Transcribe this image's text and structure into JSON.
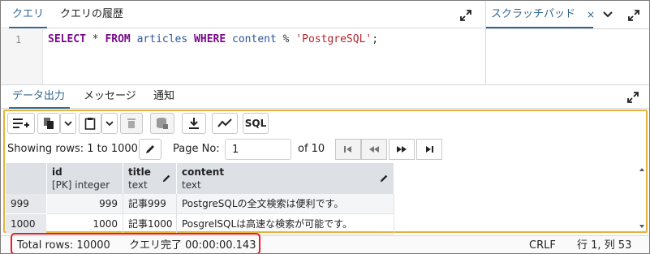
{
  "editor_tabs": {
    "query": "クエリ",
    "history": "クエリの履歴"
  },
  "scratch": {
    "label": "スクラッチパッド",
    "close": "×"
  },
  "editor": {
    "line_number": "1",
    "tokens": {
      "select": "SELECT",
      "star": " * ",
      "from": "FROM",
      "table": " articles ",
      "where": "WHERE",
      "column": " content ",
      "op": "% ",
      "literal": "'PostgreSQL'",
      "end": ";"
    }
  },
  "panel_tabs": {
    "data_output": "データ出力",
    "messages": "メッセージ",
    "notifications": "通知"
  },
  "toolbar": {
    "sql_label": "SQL"
  },
  "pager": {
    "showing": "Showing rows: 1 to 1000",
    "page_no_label": "Page No:",
    "page_value": "1",
    "of_pages": "of 10"
  },
  "grid": {
    "columns": [
      {
        "name": "id",
        "type": "[PK] integer"
      },
      {
        "name": "title",
        "type": "text"
      },
      {
        "name": "content",
        "type": "text"
      }
    ],
    "rows": [
      {
        "rownum": "999",
        "id": "999",
        "title": "記事999",
        "content": "PostgreSQLの全文検索は便利です。"
      },
      {
        "rownum": "1000",
        "id": "1000",
        "title": "記事1000",
        "content": "PosgrelSQLは高速な検索が可能です。"
      }
    ]
  },
  "status": {
    "total_rows": "Total rows: 10000",
    "query_done": "クエリ完了 00:00:00.143",
    "line_ending": "CRLF",
    "cursor": "行 1, 列 53"
  },
  "colors": {
    "accent": "#326690",
    "highlight_border": "#e6b23e",
    "status_box": "#e1202b",
    "keyword": "#7a0a8c",
    "string": "#b5242f"
  }
}
